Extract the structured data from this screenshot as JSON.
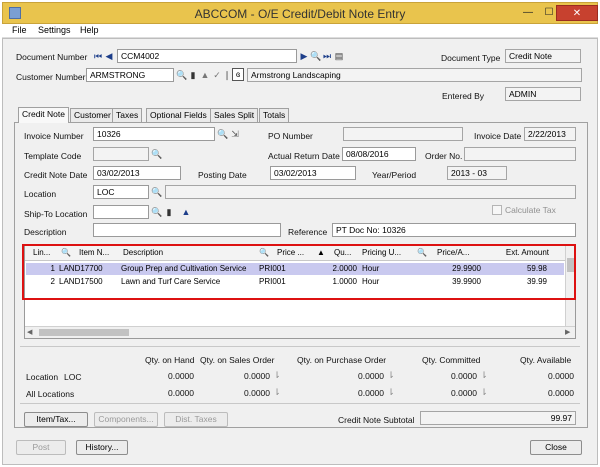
{
  "window": {
    "title": "ABCCOM - O/E Credit/Debit Note Entry",
    "minimize": "—",
    "maximize": "☐",
    "close": "✕"
  },
  "menu": {
    "file": "File",
    "settings": "Settings",
    "help": "Help"
  },
  "header": {
    "document_number_label": "Document Number",
    "document_number_value": "CCM4002",
    "document_type_label": "Document Type",
    "document_type_value": "Credit Note",
    "customer_number_label": "Customer Number",
    "customer_number_value": "ARMSTRONG",
    "customer_name_value": "Armstrong Landscaping",
    "entered_by_label": "Entered By",
    "entered_by_value": "ADMIN"
  },
  "tabs": [
    "Credit Note",
    "Customer",
    "Taxes",
    "Optional Fields",
    "Sales Split",
    "Totals"
  ],
  "form": {
    "invoice_number_label": "Invoice Number",
    "invoice_number_value": "10326",
    "po_number_label": "PO Number",
    "po_number_value": "",
    "invoice_date_label": "Invoice Date",
    "invoice_date_value": "2/22/2013",
    "template_code_label": "Template Code",
    "template_code_value": "",
    "actual_return_date_label": "Actual Return Date",
    "actual_return_date_value": "08/08/2016",
    "order_no_label": "Order No.",
    "order_no_value": "",
    "credit_note_date_label": "Credit Note Date",
    "credit_note_date_value": "03/02/2013",
    "posting_date_label": "Posting Date",
    "posting_date_value": "03/02/2013",
    "year_period_label": "Year/Period",
    "year_period_value": "2013 - 03",
    "location_label": "Location",
    "location_value": "LOC",
    "location_desc_value": "",
    "ship_to_label": "Ship-To Location",
    "ship_to_value": "",
    "calculate_tax_label": "Calculate Tax",
    "description_label": "Description",
    "description_value": "",
    "reference_label": "Reference",
    "reference_value": "PT Doc No: 10326"
  },
  "grid": {
    "columns": [
      "Lin...",
      "Item N...",
      "Description",
      "Price ...",
      "Qu...",
      "Pricing U...",
      "Price/A...",
      "Ext. Amount"
    ],
    "rows": [
      {
        "line": "1",
        "item": "LAND17700",
        "description": "Group Prep and Cultivation Service",
        "price": "PRI001",
        "qty": "2.0000",
        "pricing_unit": "Hour",
        "price_per": "29.9900",
        "ext_amount": "59.98"
      },
      {
        "line": "2",
        "item": "LAND17500",
        "description": "Lawn and Turf Care Service",
        "price": "PRI001",
        "qty": "1.0000",
        "pricing_unit": "Hour",
        "price_per": "39.9900",
        "ext_amount": "39.99"
      }
    ]
  },
  "summary": {
    "headers": [
      "Qty. on Hand",
      "Qty. on Sales Order",
      "Qty. on Purchase Order",
      "Qty. Committed",
      "Qty. Available"
    ],
    "location_label": "Location",
    "location_code": "LOC",
    "all_locations_label": "All Locations",
    "location_values": [
      "0.0000",
      "0.0000",
      "0.0000",
      "0.0000",
      "0.0000"
    ],
    "all_values": [
      "0.0000",
      "0.0000",
      "0.0000",
      "0.0000",
      "0.0000"
    ]
  },
  "bottom": {
    "item_tax": "Item/Tax...",
    "components": "Components...",
    "dist_taxes": "Dist. Taxes",
    "subtotal_label": "Credit Note Subtotal",
    "subtotal_value": "99.97",
    "post": "Post",
    "history": "History...",
    "close": "Close"
  },
  "colors": {
    "title_bar": "#e9c44d",
    "close_button": "#c7412f",
    "highlight_border": "#dd1111",
    "selected_row": "#c9c9ef"
  }
}
